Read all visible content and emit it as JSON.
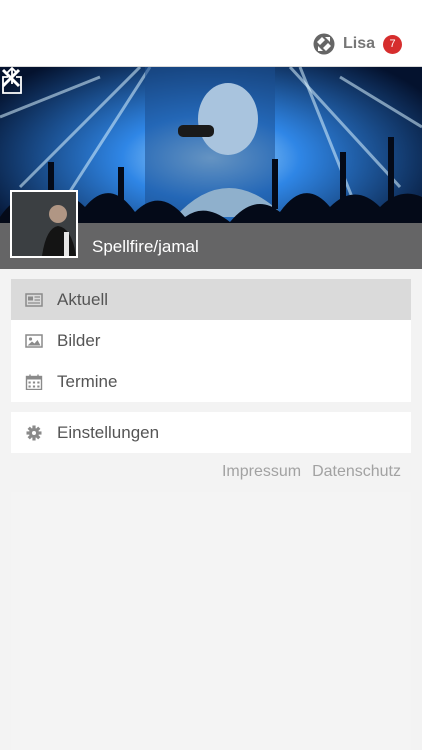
{
  "header": {
    "user_name": "Lisa",
    "notification_count": "7",
    "logo_icon": "app-logo-icon"
  },
  "hero": {
    "title": "Spellfire/jamal",
    "share_icon": "share-icon",
    "close_icon": "close-icon"
  },
  "menu": {
    "items": [
      {
        "label": "Aktuell",
        "icon": "newspaper-icon",
        "active": true
      },
      {
        "label": "Bilder",
        "icon": "image-icon",
        "active": false
      },
      {
        "label": "Termine",
        "icon": "calendar-icon",
        "active": false
      }
    ],
    "settings": {
      "label": "Einstellungen",
      "icon": "gear-icon"
    }
  },
  "footer": {
    "impressum": "Impressum",
    "datenschutz": "Datenschutz"
  },
  "colors": {
    "badge": "#d62d2d",
    "active_item": "#dadada",
    "hero_bar": "#6e6e6e"
  }
}
